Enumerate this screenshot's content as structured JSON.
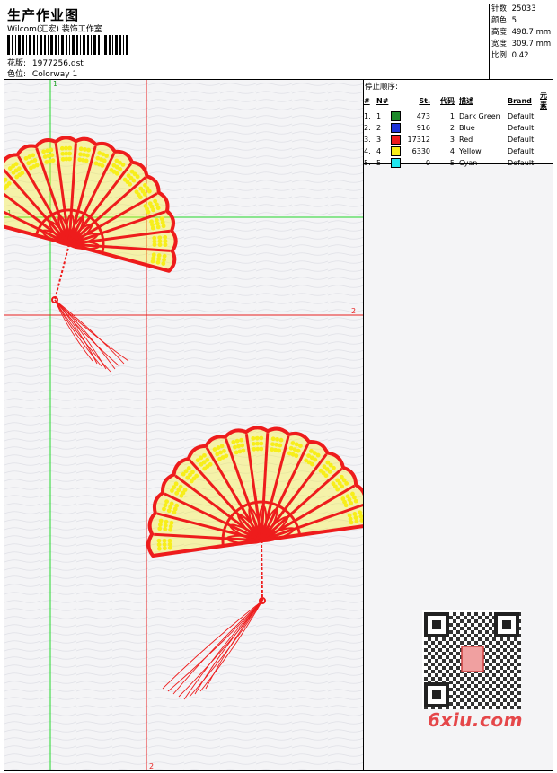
{
  "header": {
    "title": "生产作业图",
    "subtitle": "Wilcom(汇宏) 装饰工作室",
    "design_label": "花版:",
    "design_value": "1977256.dst",
    "colorway_label": "色位:",
    "colorway_value": "Colorway 1"
  },
  "info": [
    {
      "label": "针数:",
      "value": "25033"
    },
    {
      "label": "颜色:",
      "value": "5"
    },
    {
      "label": "高度:",
      "value": "498.7 mm"
    },
    {
      "label": "宽度:",
      "value": "309.7 mm"
    },
    {
      "label": "比例:",
      "value": "0.42"
    }
  ],
  "stop_sequence": {
    "title": "停止顺序:",
    "headers": [
      "#",
      "N#",
      "St.",
      "代码",
      "描述",
      "Brand",
      "元素"
    ],
    "rows": [
      {
        "idx": "1.",
        "n": "1",
        "color": "#1f8a2c",
        "st": "473",
        "code": "1",
        "desc": "Dark Green",
        "brand": "Default"
      },
      {
        "idx": "2.",
        "n": "2",
        "color": "#1f33d8",
        "st": "916",
        "code": "2",
        "desc": "Blue",
        "brand": "Default"
      },
      {
        "idx": "3.",
        "n": "3",
        "color": "#ee1c1c",
        "st": "17312",
        "code": "3",
        "desc": "Red",
        "brand": "Default"
      },
      {
        "idx": "4.",
        "n": "4",
        "color": "#f7ee1a",
        "st": "6330",
        "code": "4",
        "desc": "Yellow",
        "brand": "Default"
      },
      {
        "idx": "5.",
        "n": "5",
        "color": "#22e6ee",
        "st": "0",
        "code": "5",
        "desc": "Cyan",
        "brand": "Default"
      }
    ]
  },
  "guides": {
    "v1_label": "1",
    "h1_label": "1",
    "h2_label": "2",
    "v2_label": "2"
  },
  "watermark": "6xiu.com",
  "colors": {
    "red": "#ee1c1c",
    "yellow": "#f7ee1a",
    "guide_green": "#22d62a",
    "guide_red": "#e82020"
  }
}
